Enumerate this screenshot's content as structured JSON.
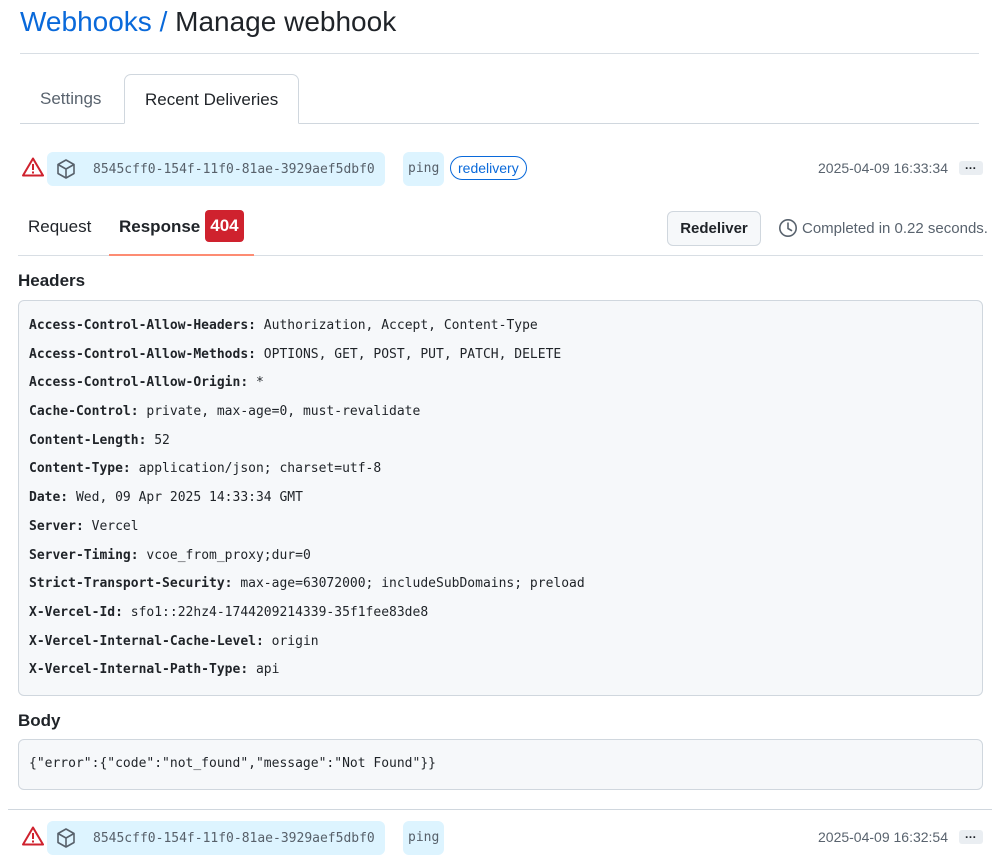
{
  "breadcrumb": {
    "parent": "Webhooks",
    "separator": " / ",
    "title": "Manage webhook"
  },
  "tabs": [
    {
      "label": "Settings",
      "selected": false
    },
    {
      "label": "Recent Deliveries",
      "selected": true
    }
  ],
  "deliveries": [
    {
      "status_icon": "alert-icon",
      "guid": "8545cff0-154f-11f0-81ae-3929aef5dbf0",
      "event": "ping",
      "badge": "redelivery",
      "timestamp": "2025-04-09 16:33:34",
      "more_label": "…"
    },
    {
      "status_icon": "alert-icon",
      "guid": "8545cff0-154f-11f0-81ae-3929aef5dbf0",
      "event": "ping",
      "timestamp": "2025-04-09 16:32:54",
      "more_label": "…"
    }
  ],
  "detail": {
    "tabs": {
      "request": "Request",
      "response": "Response"
    },
    "status_code": "404",
    "redeliver_label": "Redeliver",
    "completed_text": "Completed in 0.22 seconds.",
    "headers_title": "Headers",
    "headers": [
      {
        "key": "Access-Control-Allow-Headers:",
        "value": " Authorization, Accept, Content-Type"
      },
      {
        "key": "Access-Control-Allow-Methods:",
        "value": " OPTIONS, GET, POST, PUT, PATCH, DELETE"
      },
      {
        "key": "Access-Control-Allow-Origin:",
        "value": " *"
      },
      {
        "key": "Cache-Control:",
        "value": " private, max-age=0, must-revalidate"
      },
      {
        "key": "Content-Length:",
        "value": " 52"
      },
      {
        "key": "Content-Type:",
        "value": " application/json; charset=utf-8"
      },
      {
        "key": "Date:",
        "value": " Wed, 09 Apr 2025 14:33:34 GMT"
      },
      {
        "key": "Server:",
        "value": " Vercel"
      },
      {
        "key": "Server-Timing:",
        "value": " vcoe_from_proxy;dur=0"
      },
      {
        "key": "Strict-Transport-Security:",
        "value": " max-age=63072000; includeSubDomains; preload"
      },
      {
        "key": "X-Vercel-Id:",
        "value": " sfo1::22hz4-1744209214339-35f1fee83de8"
      },
      {
        "key": "X-Vercel-Internal-Cache-Level:",
        "value": " origin"
      },
      {
        "key": "X-Vercel-Internal-Path-Type:",
        "value": " api"
      }
    ],
    "body_title": "Body",
    "body": "{\"error\":{\"code\":\"not_found\",\"message\":\"Not Found\"}}"
  },
  "colors": {
    "link": "#0969da",
    "danger": "#cf222e",
    "pill_bg": "#ddf4ff",
    "active_tab_underline": "#fd8c73"
  }
}
